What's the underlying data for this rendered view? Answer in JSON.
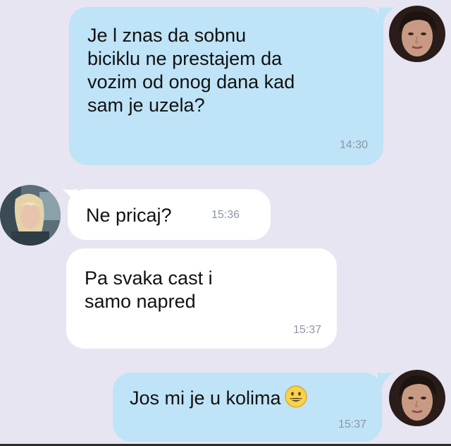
{
  "messages": [
    {
      "direction": "outgoing",
      "text": "Je l znas da sobnu\nbiciklu ne prestajem da\nvozim od onog dana kad\nsam je uzela?",
      "time": "14:30"
    },
    {
      "direction": "incoming",
      "text": "Ne pricaj?",
      "time": "15:36"
    },
    {
      "direction": "incoming",
      "text": "Pa svaka cast i\nsamo napred",
      "time": "15:37"
    },
    {
      "direction": "outgoing",
      "text": "Jos mi je u kolima",
      "emoji": "grinning-face",
      "time": "15:37"
    }
  ],
  "colors": {
    "background": "#e6e5f1",
    "outgoing_bubble": "#bfe3f7",
    "incoming_bubble": "#ffffff",
    "timestamp": "#8d96a6"
  },
  "avatars": {
    "outgoing": "dark-haired-woman-avatar",
    "incoming": "blonde-woman-avatar"
  }
}
